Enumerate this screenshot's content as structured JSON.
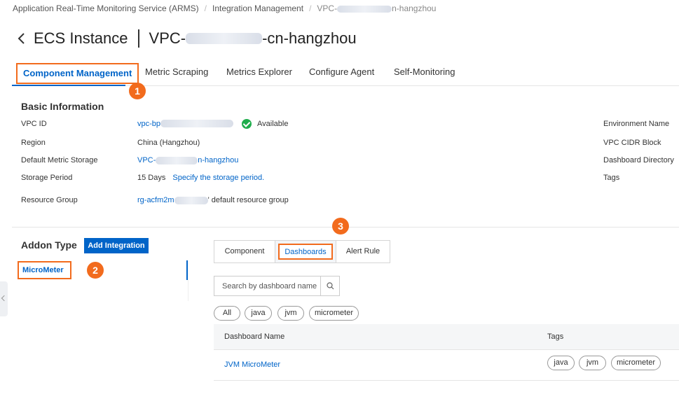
{
  "breadcrumb": {
    "items": [
      "Application Real-Time Monitoring Service (ARMS)",
      "Integration Management"
    ],
    "current_prefix": "VPC-",
    "current_suffix": "n-hangzhou"
  },
  "header": {
    "title": "ECS Instance",
    "vpc_prefix": "VPC-",
    "vpc_suffix": "-cn-hangzhou"
  },
  "tabs": [
    "Component Management",
    "Metric Scraping",
    "Metrics Explorer",
    "Configure Agent",
    "Self-Monitoring"
  ],
  "annotations": [
    "1",
    "2",
    "3"
  ],
  "basic_info": {
    "title": "Basic Information",
    "vpc_id_label": "VPC ID",
    "vpc_id_prefix": "vpc-bp",
    "status": "Available",
    "region_label": "Region",
    "region_value": "China (Hangzhou)",
    "storage_label": "Default Metric Storage",
    "storage_prefix": "VPC-",
    "storage_suffix": "n-hangzhou",
    "period_label": "Storage Period",
    "period_value": "15 Days",
    "period_link": "Specify the storage period.",
    "rg_label": "Resource Group",
    "rg_prefix": "rg-acfm2m",
    "rg_suffix": "' default resource group",
    "right_labels": [
      "Environment Name",
      "VPC CIDR Block",
      "Dashboard Directory",
      "Tags"
    ]
  },
  "addon": {
    "title": "Addon Type",
    "add_button": "Add Integration",
    "items": [
      "MicroMeter"
    ]
  },
  "segments": [
    "Component",
    "Dashboards",
    "Alert Rule"
  ],
  "search": {
    "placeholder": "Search by dashboard name"
  },
  "filter_tags": [
    "All",
    "java",
    "jvm",
    "micrometer"
  ],
  "table": {
    "columns": [
      "Dashboard Name",
      "Tags"
    ],
    "rows": [
      {
        "name": "JVM MicroMeter",
        "tags": [
          "java",
          "jvm",
          "micrometer"
        ]
      }
    ]
  },
  "colors": {
    "accent": "#0064c8",
    "highlight": "#f26b1d",
    "success": "#1fad4c"
  }
}
